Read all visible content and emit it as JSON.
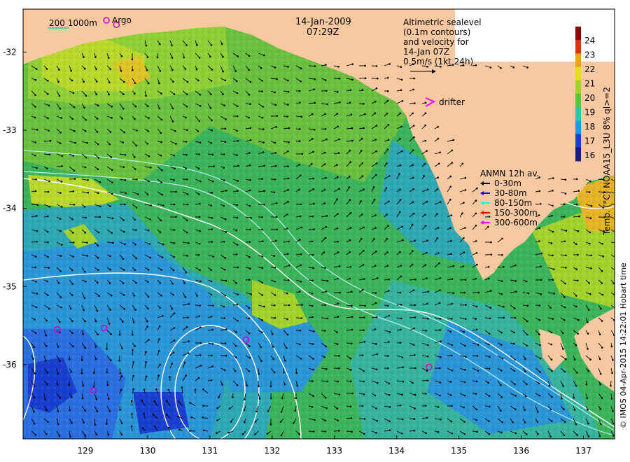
{
  "header": {
    "date": "14-Jan-2009",
    "time": "07:29Z"
  },
  "scale_legend": {
    "contour_labels": "200  1000m",
    "argo_label": "Argo"
  },
  "info_box": {
    "line1": "Altimetric sealevel",
    "line2": "(0.1m contours)",
    "line3": "and velocity for",
    "line4": "14-Jan 07Z",
    "line5": "0.5m/s (1kt 24h)"
  },
  "drifter_label": "drifter",
  "anmn": {
    "title": "ANMN 12h av.",
    "items": [
      {
        "label": "0-30m",
        "color": "#000000"
      },
      {
        "label": "30-80m",
        "color": "#0000ff"
      },
      {
        "label": "80-150m",
        "color": "#00ffff"
      },
      {
        "label": "150-300m",
        "color": "#ff0000"
      },
      {
        "label": "300-600m",
        "color": "#ff00ff"
      }
    ]
  },
  "colorbar": {
    "label": "Temp. (°C) NOAA15_L3U 8% ql>=2",
    "ticks": [
      "16",
      "17",
      "18",
      "19",
      "20",
      "21",
      "22",
      "23",
      "24"
    ],
    "colors": [
      "#1a1a7a",
      "#1a3fd0",
      "#1f9ae6",
      "#2cc6a8",
      "#5cc23c",
      "#a4d22c",
      "#e6dc1e",
      "#f0a020",
      "#d23a14",
      "#8a0a0a"
    ]
  },
  "credit": "© IMOS 04-Apr-2015 14:22:01 Hobart time",
  "axes": {
    "lat_labels": [
      "-32",
      "-33",
      "-34",
      "-35",
      "-36"
    ],
    "lon_labels": [
      "129",
      "130",
      "131",
      "132",
      "133",
      "134",
      "135",
      "136",
      "137"
    ]
  },
  "argo_floats": [
    {
      "lon": 128.55,
      "lat": -35.55
    },
    {
      "lon": 129.3,
      "lat": -35.53
    },
    {
      "lon": 129.13,
      "lat": -36.33
    },
    {
      "lon": 131.58,
      "lat": -35.68
    },
    {
      "lon": 134.52,
      "lat": -36.03
    },
    {
      "lon": 129.5,
      "lat": -31.65
    }
  ],
  "colors": {
    "land": "#f8c8a0",
    "contour": "#b8ecf0",
    "sealevel": "#ffffff",
    "argo": "#cc00cc"
  }
}
